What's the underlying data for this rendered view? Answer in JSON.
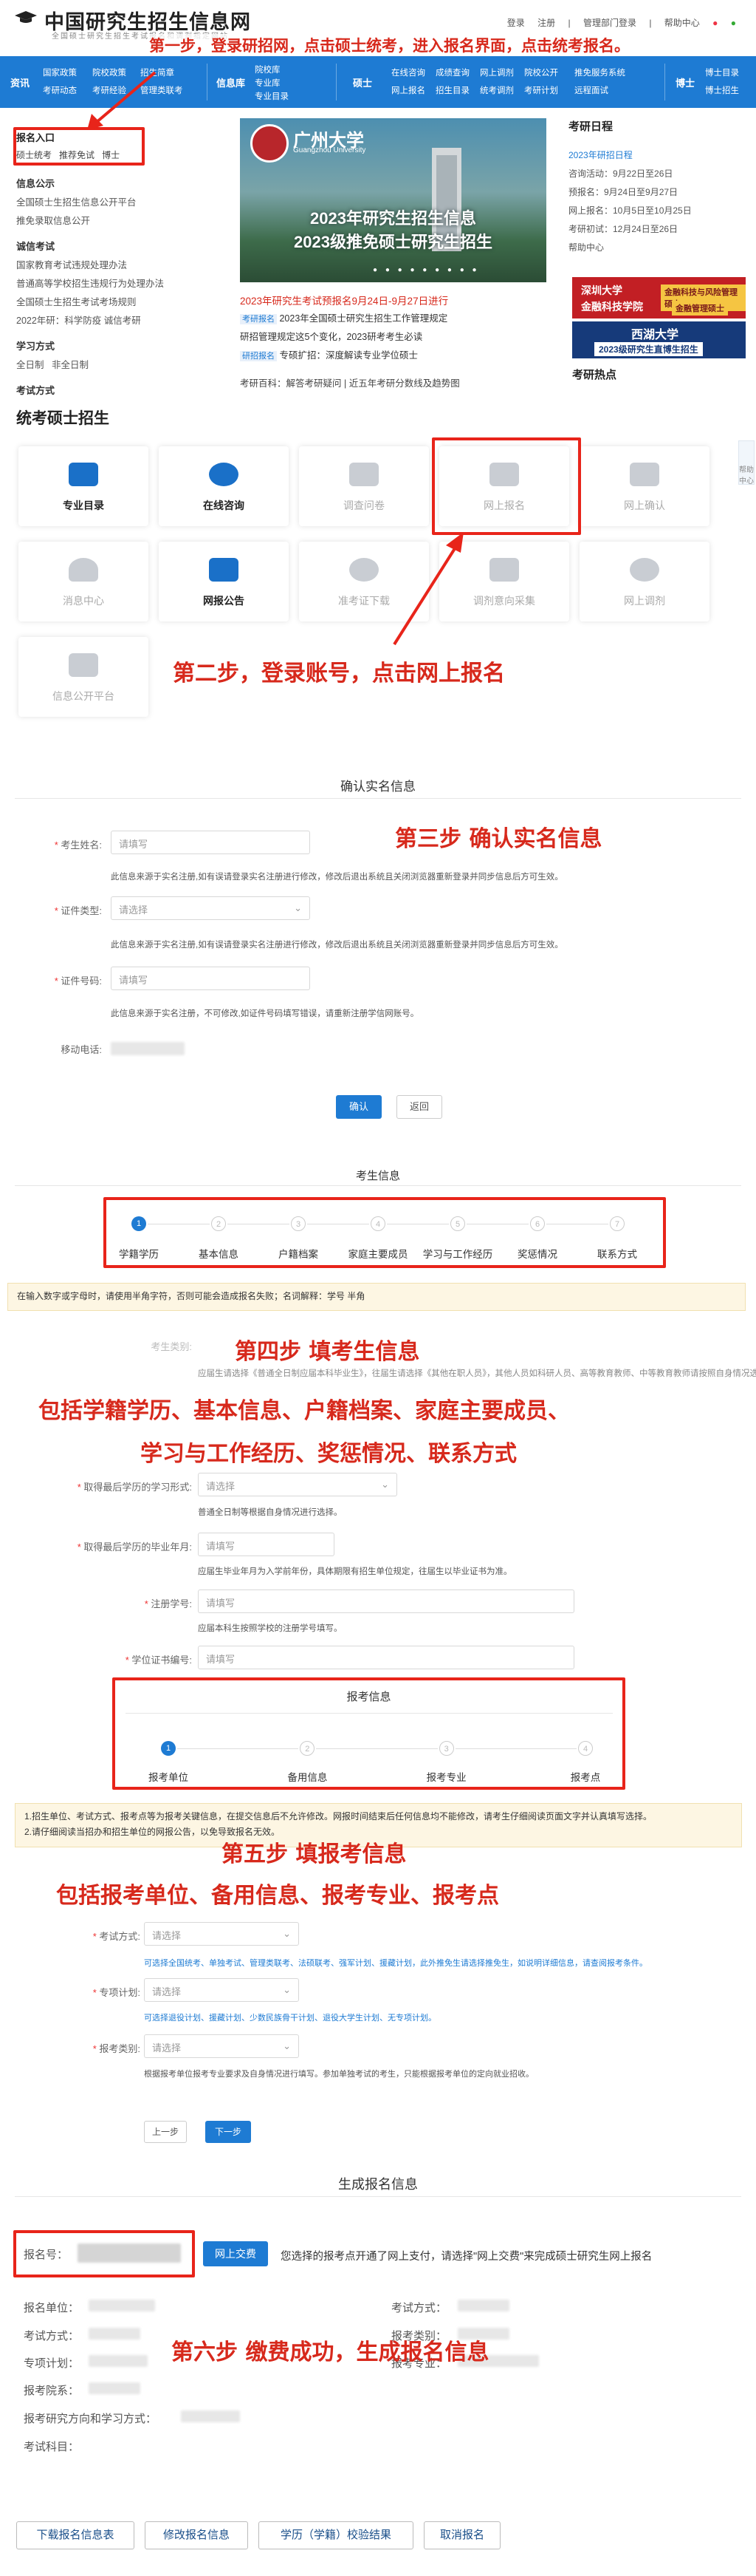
{
  "header": {
    "site_title": "中国研究生招生信息网",
    "site_subtitle": "全国硕士研究生招生考试报名和调剂指定网站",
    "links": [
      "登录",
      "注册",
      "|",
      "管理部门登录",
      "|",
      "帮助中心"
    ]
  },
  "nav": {
    "groups": [
      {
        "head": "资讯",
        "items": [
          "国家政策",
          "院校政策",
          "招生简章",
          "考研动态",
          "考研经验",
          "管理类联考"
        ]
      },
      {
        "head": "信息库",
        "items": [
          "院校库",
          "专业库",
          "专业目录"
        ]
      },
      {
        "head": "硕士",
        "items": [
          "在线咨询",
          "成绩查询",
          "网上调剂",
          "院校公开",
          "推免服务系统",
          "网上报名",
          "招生目录",
          "统考调剂",
          "考研计划",
          "远程面试"
        ]
      },
      {
        "head": "博士",
        "items": [
          "博士目录",
          "博士招生"
        ]
      }
    ]
  },
  "left_panel": {
    "entry_title": "报名入口",
    "entry_items": [
      "硕士统考",
      "推荐免试",
      "博士"
    ],
    "sections": [
      {
        "title": "信息公示",
        "items": [
          "全国硕士生招生信息公开平台",
          "推免录取信息公开"
        ]
      },
      {
        "title": "诚信考试",
        "items": [
          "国家教育考试违规处理办法",
          "普通高等学校招生违规行为处理办法",
          "全国硕士生招生考试考场规则",
          "2022年研：科学防疫 诚信考研"
        ]
      },
      {
        "title": "学习方式",
        "items": [
          "全日制",
          "非全日制"
        ]
      },
      {
        "title": "考试方式",
        "items": []
      }
    ]
  },
  "banner": {
    "university": "广州大学",
    "university_en": "Guangzhou University",
    "line1": "2023年研究生招生信息",
    "line2": "2023级推免硕士研究生招生"
  },
  "news": {
    "headline": "2023年研究生考试预报名9月24日-9月27日进行",
    "items": [
      {
        "tag": "考研报名",
        "text": "2023年全国硕士研究生招生工作管理规定"
      },
      {
        "tag": "",
        "text": "研招管理规定这5个变化，2023研考考生必读"
      },
      {
        "tag": "研招报名",
        "text": "专硕扩招：深度解读专业学位硕士"
      }
    ],
    "footer": "考研百科：解答考研疑问 | 近五年考研分数线及趋势图"
  },
  "right_panel": {
    "title": "考研日程",
    "schedule_title": "2023年研招日程",
    "items": [
      "咨询活动：9月22日至26日",
      "预报名：9月24日至9月27日",
      "网上报名：10月5日至10月25日",
      "考研初试：12月24日至26日",
      "帮助中心"
    ],
    "ad1_title": "深圳大学",
    "ad1_sub": "金融科技学院",
    "ad1_note": "金融科技与风险管理硕士",
    "ad1_note2": "金融管理硕士",
    "ad2_title": "西湖大学",
    "ad2_sub": "2023级研究生直博生招生",
    "hot_title": "考研热点"
  },
  "section_tiles": {
    "title": "统考硕士招生",
    "tiles": [
      {
        "label": "专业目录",
        "icon": "folder-icon",
        "state": "on"
      },
      {
        "label": "在线咨询",
        "icon": "question-icon",
        "state": "on"
      },
      {
        "label": "调查问卷",
        "icon": "edit-icon",
        "state": "off"
      },
      {
        "label": "网上报名",
        "icon": "form-icon",
        "state": "off"
      },
      {
        "label": "网上确认",
        "icon": "image-icon",
        "state": "off"
      },
      {
        "label": "消息中心",
        "icon": "bell-icon",
        "state": "off"
      },
      {
        "label": "网报公告",
        "icon": "briefcase-icon",
        "state": "on"
      },
      {
        "label": "准考证下载",
        "icon": "download-icon",
        "state": "off"
      },
      {
        "label": "调剂意向采集",
        "icon": "document-icon",
        "state": "off"
      },
      {
        "label": "网上调剂",
        "icon": "refresh-icon",
        "state": "off"
      },
      {
        "label": "信息公开平台",
        "icon": "megaphone-icon",
        "state": "off"
      }
    ],
    "side_chip": "帮助中心"
  },
  "verify": {
    "title": "确认实名信息",
    "fields": [
      {
        "label": "考生姓名:",
        "required": true,
        "placeholder": "请填写",
        "hint": "此信息来源于实名注册,如有误请登录实名注册进行修改，修改后退出系统且关闭浏览器重新登录并同步信息后方可生效。"
      },
      {
        "label": "证件类型:",
        "required": true,
        "placeholder": "请选择",
        "hint": "此信息来源于实名注册,如有误请登录实名注册进行修改，修改后退出系统且关闭浏览器重新登录并同步信息后方可生效。"
      },
      {
        "label": "证件号码:",
        "required": true,
        "placeholder": "请填写",
        "hint": "此信息来源于实名注册，不可修改,如证件号码填写错误，请重新注册学信网账号。"
      },
      {
        "label": "移动电话:",
        "required": false,
        "placeholder": "",
        "hint": ""
      }
    ],
    "confirm": "确认",
    "back": "返回"
  },
  "exam_info": {
    "title": "考生信息",
    "steps": [
      "学籍学历",
      "基本信息",
      "户籍档案",
      "家庭主要成员",
      "学习与工作经历",
      "奖惩情况",
      "联系方式"
    ],
    "notice": "在输入数字或字母时，请使用半角字符，否则可能会造成报名失败；名词解释：学号 半角",
    "fields": [
      {
        "label": "考生类别:",
        "placeholder": "",
        "hint": "应届生请选择《普通全日制应届本科毕业生》，往届生请选择《其他在职人员》，其他人员如科研人员、高等教育教师、中等教育教师请按照自身情况选择。"
      },
      {
        "label": "取得最后学历的学习形式:",
        "placeholder": "请选择",
        "hint": "普通全日制等根据自身情况进行选择。"
      },
      {
        "label": "取得最后学历的毕业年月:",
        "placeholder": "请填写",
        "hint": "应届生毕业年月为入学前年份，具体期限有招生单位规定，往届生以毕业证书为准。"
      },
      {
        "label": "注册学号:",
        "placeholder": "请填写",
        "hint": "应届本科生按照学校的注册学号填写。"
      },
      {
        "label": "学位证书编号:",
        "placeholder": "请填写",
        "hint": ""
      }
    ]
  },
  "apply_info": {
    "title": "报考信息",
    "steps": [
      "报考单位",
      "备用信息",
      "报考专业",
      "报考点"
    ],
    "notice_line1": "1.招生单位、考试方式、报考点等为报考关键信息，在提交信息后不允许修改。网报时间结束后任何信息均不能修改，请考生仔细阅读页面文字并认真填写选择。",
    "notice_line2": "2.请仔细阅读当招办和招生单位的网报公告，以免导致报名无效。",
    "fields": [
      {
        "label": "考试方式:",
        "placeholder": "请选择",
        "hint": "可选择全国统考、单独考试、管理类联考、法硕联考、强军计划、援藏计划，此外推免生请选择推免生，如说明详细信息，请查阅报考条件。"
      },
      {
        "label": "专项计划:",
        "placeholder": "请选择",
        "hint": "可选择退役计划、援藏计划、少数民族骨干计划、退役大学生计划、无专项计划。"
      },
      {
        "label": "报考类别:",
        "placeholder": "请选择",
        "hint": "根据报考单位报考专业要求及自身情况进行填写。参加单独考试的考生，只能根据报考单位的定向就业招收。"
      }
    ],
    "prev": "上一步",
    "next": "下一步"
  },
  "generate": {
    "title": "生成报名信息",
    "reg_no_label": "报名号：",
    "pay_button": "网上交费",
    "pay_text": "您选择的报考点开通了网上支付，请选择\"网上交费\"来完成硕士研究生网上报名",
    "labels_left": [
      "报名单位：",
      "考试方式：",
      "专项计划：",
      "报考院系：",
      "报考研究方向和学习方式：",
      "考试科目："
    ],
    "labels_right": [
      "考试方式：",
      "报考类别：",
      "报考专业："
    ],
    "buttons": [
      "下载报名信息表",
      "修改报名信息",
      "学历（学籍）校验结果",
      "取消报名"
    ]
  },
  "annotations": {
    "step1": "第一步，登录研招网，点击硕士统考，进入报名界面，点击统考报名。",
    "step2": "第二步，登录账号，点击网上报名",
    "step3": "第三步  确认实名信息",
    "step4": "第四步  填考生信息",
    "step4_line2": "包括学籍学历、基本信息、户籍档案、家庭主要成员、",
    "step4_line3": "学习与工作经历、奖惩情况、联系方式",
    "step5": "第五步  填报考信息",
    "step5_line2": "包括报考单位、备用信息、报考专业、报考点",
    "step6": "第六步  缴费成功，生成报名信息"
  },
  "colors": {
    "brand_blue": "#1e7bd3",
    "annotation_red": "#d7291c",
    "notice_bg": "#fdf6e3"
  }
}
